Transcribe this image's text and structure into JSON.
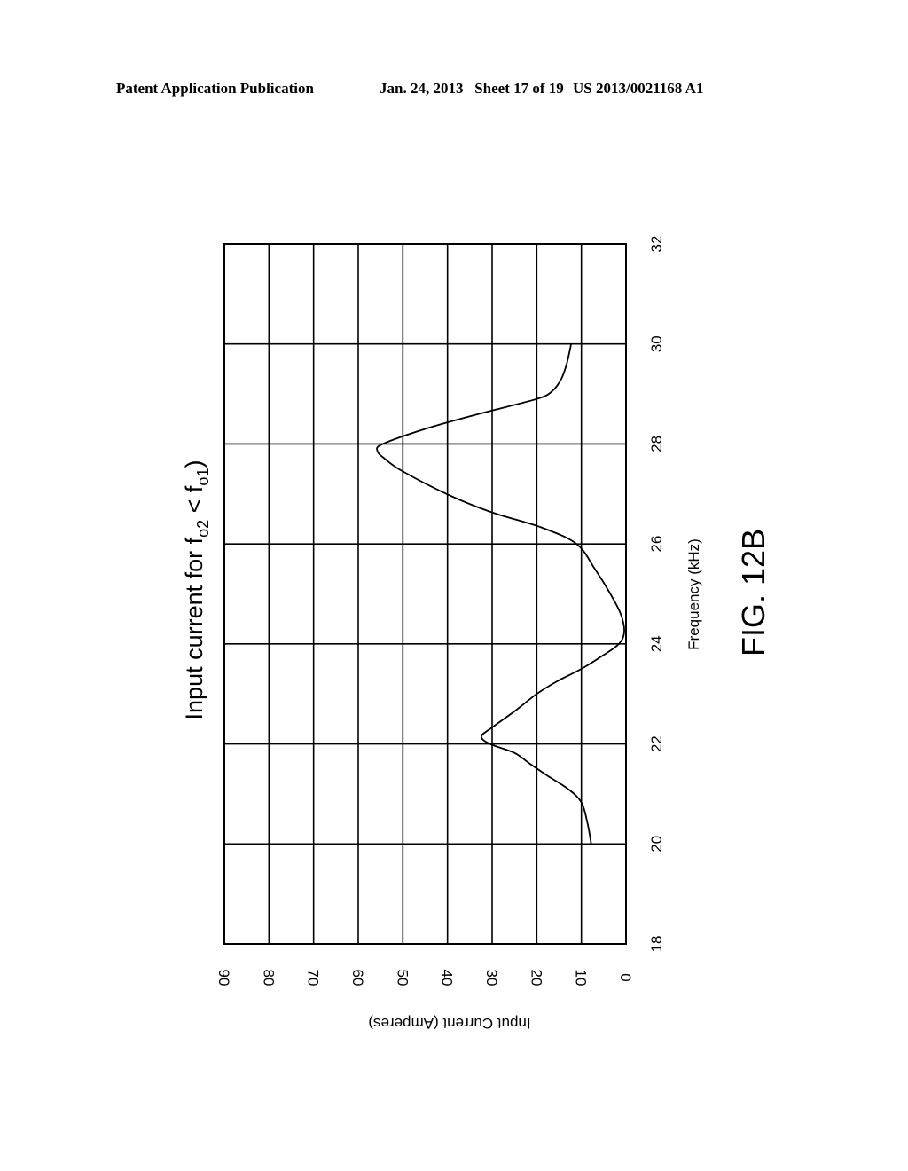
{
  "header": {
    "publication": "Patent Application Publication",
    "date_sheet": "Jan. 24, 2013   Sheet 17 of 19",
    "patent_number": "US 2013/0021168 A1"
  },
  "figure_label": "FIG. 12B",
  "chart_data": {
    "type": "line",
    "orientation": "rotated 90 degrees counter-clockwise on page",
    "title": "Input current for f_o2 < f_o1",
    "title_parts": {
      "prefix": "Input current for f",
      "sub1": "o2",
      "mid": " < f",
      "sub2": "o1",
      "suffix": ")"
    },
    "xlabel": "Frequency (kHz)",
    "ylabel": "Input Current (Amperes)",
    "xlim": [
      18,
      32
    ],
    "ylim": [
      0,
      90
    ],
    "xticks": [
      "18",
      "20",
      "22",
      "24",
      "26",
      "28",
      "30",
      "32"
    ],
    "yticks": [
      "0",
      "10",
      "20",
      "30",
      "40",
      "50",
      "60",
      "70",
      "80",
      "90"
    ],
    "grid": true,
    "legend": "none",
    "series": [
      {
        "name": "Input current",
        "x": [
          20.0,
          20.4,
          20.83,
          21.1,
          21.37,
          21.6,
          21.82,
          22.0,
          22.15,
          22.33,
          22.65,
          23.0,
          23.25,
          23.5,
          23.75,
          24.0,
          24.25,
          24.6,
          25.0,
          25.5,
          26.0,
          26.33,
          26.63,
          26.99,
          27.45,
          27.7,
          27.86,
          28.0,
          28.3,
          28.6,
          28.9,
          29.06,
          29.3,
          29.6,
          30.0
        ],
        "y": [
          7.8,
          8.6,
          10.0,
          13.0,
          17.7,
          21.5,
          25.0,
          30.5,
          32.4,
          30.0,
          25.0,
          20.0,
          15.5,
          10.0,
          5.5,
          1.6,
          0.4,
          1.2,
          3.5,
          7.0,
          11.1,
          19.0,
          30.0,
          40.0,
          50.0,
          54.0,
          55.7,
          54.5,
          45.0,
          33.0,
          20.0,
          16.5,
          14.5,
          13.3,
          12.3
        ]
      }
    ]
  }
}
